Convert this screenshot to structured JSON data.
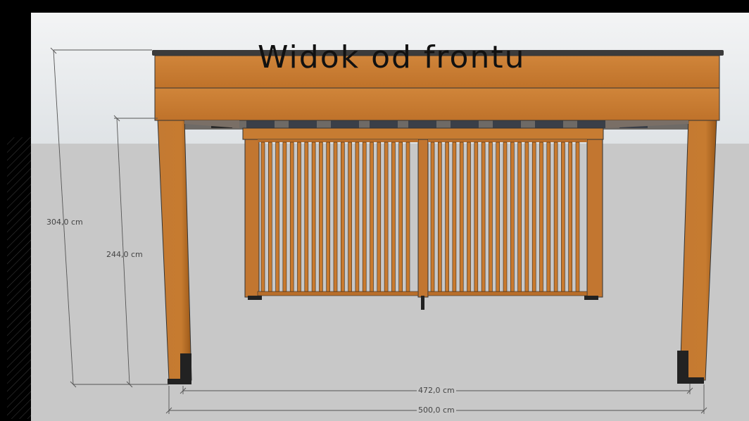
{
  "title": "Widok od frontu",
  "dimensions": {
    "total_height": "304,0 cm",
    "clear_height": "244,0 cm",
    "inner_width": "472,0 cm",
    "total_width": "500,0 cm"
  },
  "colors": {
    "wood": "#c97a2e",
    "wood_dark": "#8a4b14",
    "sky": "#e4e7ea",
    "ground": "#c8c8c8",
    "frame": "#000000",
    "roof_edge": "#3a3a3a"
  }
}
